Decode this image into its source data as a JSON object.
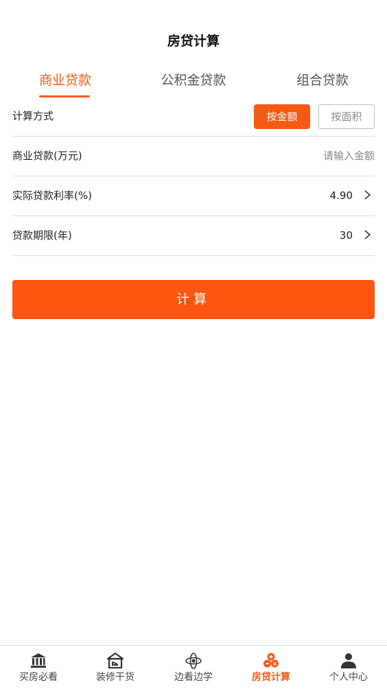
{
  "header": {
    "title": "房贷计算"
  },
  "tabs": [
    {
      "label": "商业贷款",
      "active": true
    },
    {
      "label": "公积金贷款",
      "active": false
    },
    {
      "label": "组合贷款",
      "active": false
    }
  ],
  "form": {
    "method": {
      "label": "计算方式",
      "options": [
        "按金额",
        "按面积"
      ],
      "selected": "按金额"
    },
    "loan_amount": {
      "label": "商业贷款(万元)",
      "placeholder": "请输入金额"
    },
    "rate": {
      "label": "实际贷款利率(%)",
      "value": "4.90"
    },
    "term": {
      "label": "贷款期限(年)",
      "value": "30"
    }
  },
  "calc_button": {
    "label": "计算"
  },
  "tabbar": [
    {
      "label": "买房必看",
      "icon": "bank-icon",
      "active": false
    },
    {
      "label": "装修干货",
      "icon": "house-icon",
      "active": false
    },
    {
      "label": "边看边学",
      "icon": "atom-icon",
      "active": false
    },
    {
      "label": "房贷计算",
      "icon": "calculator-coins-icon",
      "active": true
    },
    {
      "label": "个人中心",
      "icon": "user-icon",
      "active": false
    }
  ],
  "colors": {
    "accent": "#f55a14",
    "button": "#fe5511",
    "divider": "#dcdcdc"
  }
}
